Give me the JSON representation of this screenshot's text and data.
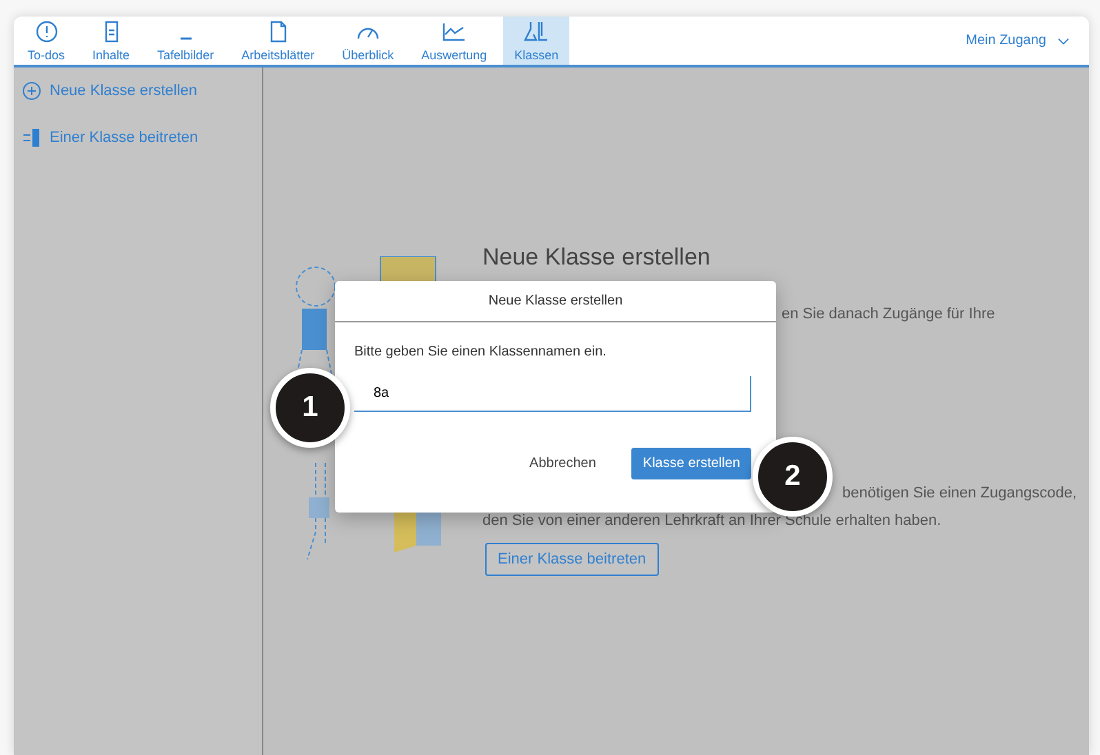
{
  "nav": {
    "tabs": [
      {
        "label": "To-dos",
        "selected": false
      },
      {
        "label": "Inhalte",
        "selected": false
      },
      {
        "label": "Tafelbilder",
        "selected": false
      },
      {
        "label": "Arbeitsblätter",
        "selected": false
      },
      {
        "label": "Überblick",
        "selected": false
      },
      {
        "label": "Auswertung",
        "selected": false
      },
      {
        "label": "Klassen",
        "selected": true
      }
    ],
    "account": "Mein Zugang"
  },
  "sidebar": {
    "items": [
      {
        "label": "Neue Klasse erstellen"
      },
      {
        "label": "Einer Klasse beitreten"
      }
    ]
  },
  "background": {
    "heading": "Neue Klasse erstellen",
    "text_1": "en Sie danach Zugänge für Ihre",
    "text_2": "benötigen Sie einen Zugangscode,",
    "text_3": "den Sie von einer anderen Lehrkraft an Ihrer Schule erhalten haben.",
    "join_button": "Einer Klasse beitreten"
  },
  "dialog": {
    "title": "Neue Klasse erstellen",
    "prompt": "Bitte geben Sie einen Klassennamen ein.",
    "value": "8a",
    "cancel": "Abbrechen",
    "confirm": "Klasse erstellen"
  },
  "badges": [
    "1",
    "2"
  ]
}
